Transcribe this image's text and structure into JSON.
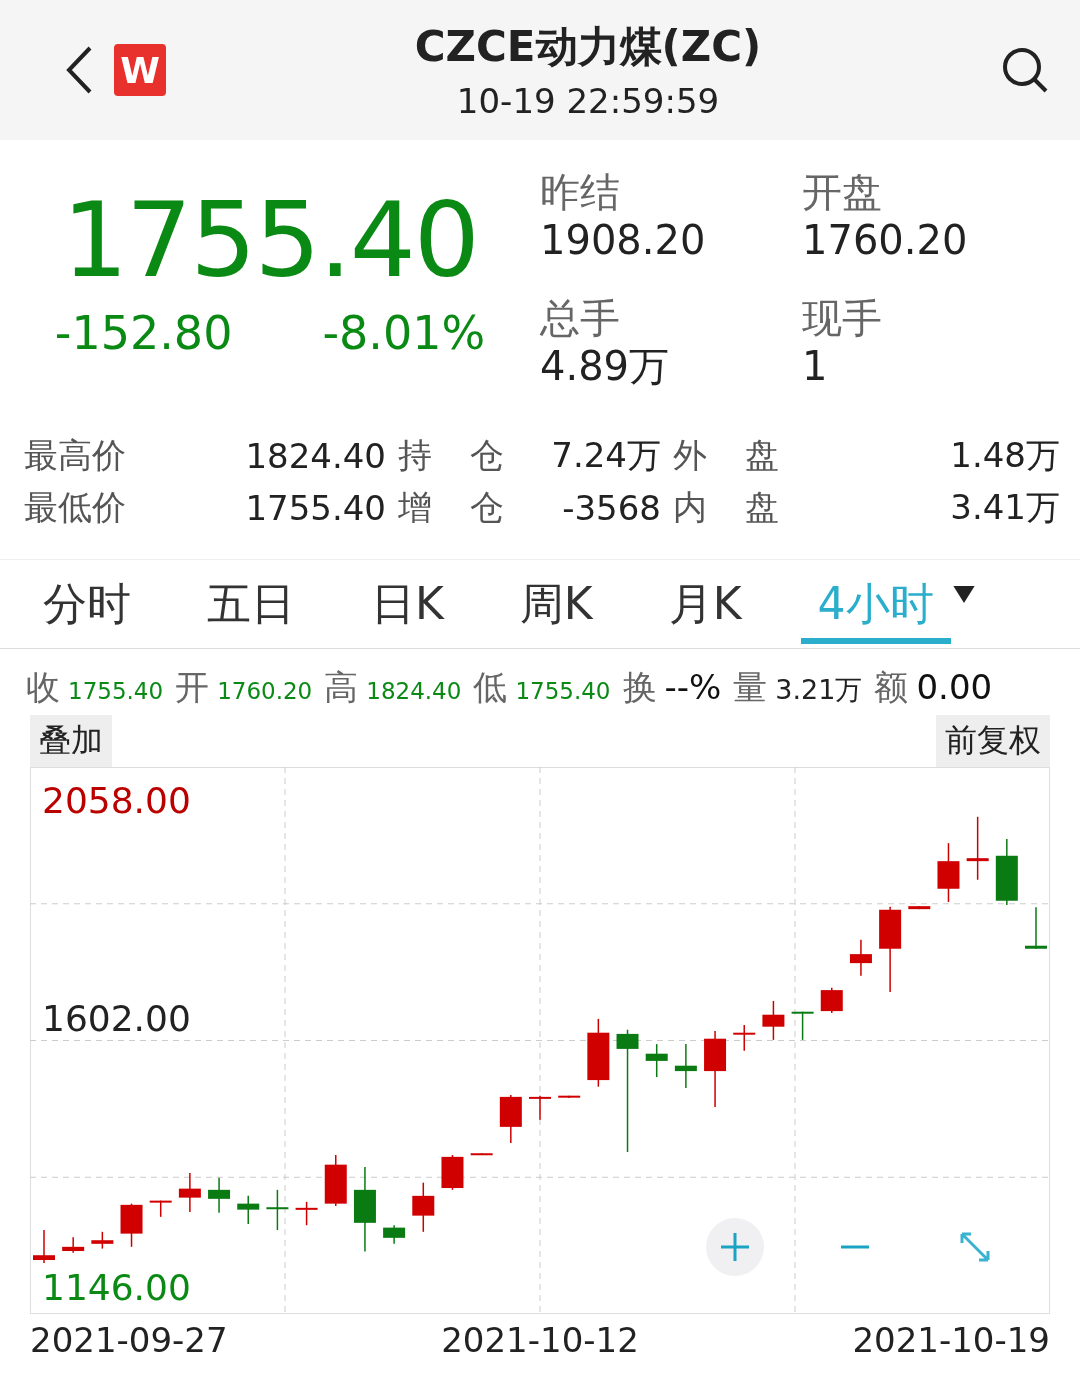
{
  "header": {
    "logo": "W",
    "title": "CZCE动力煤(ZC)",
    "time": "10-19 22:59:59"
  },
  "quote": {
    "price": "1755.40",
    "change": "-152.80",
    "change_pct": "-8.01%",
    "fields": [
      {
        "label": "昨结",
        "value": "1908.20"
      },
      {
        "label": "开盘",
        "value": "1760.20"
      },
      {
        "label": "总手",
        "value": "4.89万"
      },
      {
        "label": "现手",
        "value": "1"
      }
    ]
  },
  "stats": [
    [
      {
        "label": "最高价",
        "value": "1824.40"
      },
      {
        "label": "持仓",
        "value": "7.24万"
      },
      {
        "label": "外盘",
        "value": "1.48万"
      }
    ],
    [
      {
        "label": "最低价",
        "value": "1755.40"
      },
      {
        "label": "增仓",
        "value": "-3568"
      },
      {
        "label": "内盘",
        "value": "3.41万"
      }
    ]
  ],
  "tabs": [
    {
      "label": "分时",
      "selected": false
    },
    {
      "label": "五日",
      "selected": false
    },
    {
      "label": "日K",
      "selected": false
    },
    {
      "label": "周K",
      "selected": false
    },
    {
      "label": "月K",
      "selected": false
    },
    {
      "label": "4小时",
      "selected": true
    }
  ],
  "summary": [
    {
      "label": "收",
      "value": "1755.40",
      "kind": "price"
    },
    {
      "label": "开",
      "value": "1760.20",
      "kind": "price"
    },
    {
      "label": "高",
      "value": "1824.40",
      "kind": "price"
    },
    {
      "label": "低",
      "value": "1755.40",
      "kind": "price"
    },
    {
      "label": "换",
      "value": "--%",
      "kind": "plain"
    },
    {
      "label": "量",
      "value": "3.21万",
      "kind": "volume"
    },
    {
      "label": "额",
      "value": "0.00",
      "kind": "plain"
    }
  ],
  "chart_buttons": [
    "叠加",
    "前复权"
  ],
  "chart": {
    "y_labels": [
      "2058.00",
      "1602.00",
      "1146.00"
    ],
    "x_labels": [
      "2021-09-27",
      "2021-10-12",
      "2021-10-19"
    ]
  }
}
